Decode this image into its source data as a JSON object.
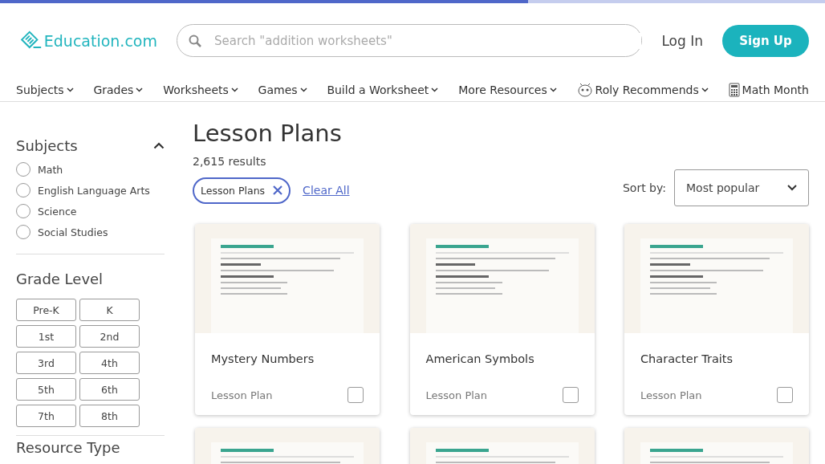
{
  "loading_bar": {
    "level": 0.64
  },
  "header": {
    "logo": "Education.com",
    "search": {
      "placeholder": "Search \"addition worksheets\""
    },
    "login": "Log In",
    "signup": "Sign Up"
  },
  "nav": [
    {
      "label": "Subjects",
      "kind": "plain"
    },
    {
      "label": "Grades",
      "kind": "plain"
    },
    {
      "label": "Worksheets",
      "kind": "plain"
    },
    {
      "label": "Games",
      "kind": "plain"
    },
    {
      "label": "Build a Worksheet",
      "kind": "plain"
    },
    {
      "label": "More Resources",
      "kind": "plain"
    },
    {
      "label": "Roly Recommends",
      "kind": "roly"
    },
    {
      "label": "Math Month",
      "kind": "calculator"
    }
  ],
  "sidebar": {
    "subjects": {
      "title": "Subjects",
      "expanded": true,
      "items": [
        {
          "label": "Math",
          "selected": false
        },
        {
          "label": "English Language Arts",
          "selected": false
        },
        {
          "label": "Science",
          "selected": false
        },
        {
          "label": "Social Studies",
          "selected": false
        }
      ]
    },
    "grade_level": {
      "title": "Grade Level",
      "grades": [
        {
          "label": "Pre-K",
          "selected": false
        },
        {
          "label": "K",
          "selected": false
        },
        {
          "label": "1st",
          "selected": false
        },
        {
          "label": "2nd",
          "selected": false
        },
        {
          "label": "3rd",
          "selected": false
        },
        {
          "label": "4th",
          "selected": false
        },
        {
          "label": "5th",
          "selected": false
        },
        {
          "label": "6th",
          "selected": false
        },
        {
          "label": "7th",
          "selected": false
        },
        {
          "label": "8th",
          "selected": false
        }
      ]
    },
    "next_section": {
      "title": "Resource Type"
    }
  },
  "main": {
    "title": "Lesson Plans",
    "results": "2,615 results",
    "filter_chip": "Lesson Plans",
    "clear_all": "Clear All",
    "sort_label": "Sort by:",
    "sort_value": "Most popular",
    "cards": [
      {
        "title": "Mystery Numbers",
        "type": "Lesson Plan",
        "checked": false
      },
      {
        "title": "American Symbols",
        "type": "Lesson Plan",
        "checked": false
      },
      {
        "title": "Character Traits",
        "type": "Lesson Plan",
        "checked": false
      }
    ]
  }
}
